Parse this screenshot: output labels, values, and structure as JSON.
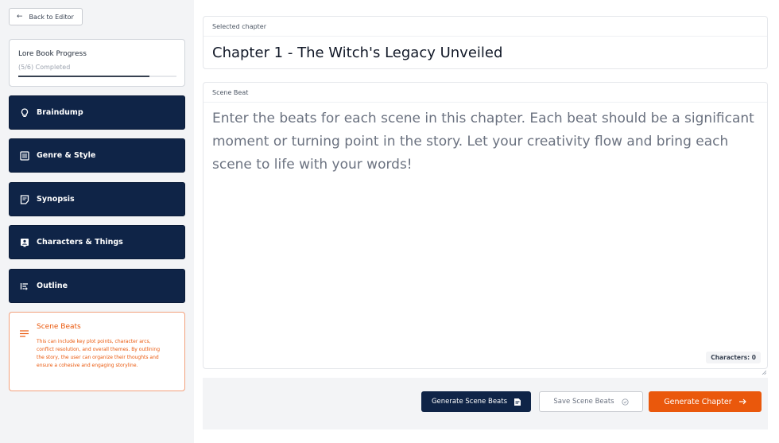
{
  "sidebar": {
    "back_label": "Back to Editor",
    "progress": {
      "title": "Lore Book Progress",
      "status": "(5/6) Completed",
      "fraction": 0.83
    },
    "items": [
      {
        "label": "Braindump",
        "icon": "lightbulb-icon"
      },
      {
        "label": "Genre & Style",
        "icon": "list-box-icon"
      },
      {
        "label": "Synopsis",
        "icon": "document-icon"
      },
      {
        "label": "Characters & Things",
        "icon": "person-card-icon"
      },
      {
        "label": "Outline",
        "icon": "outline-list-icon"
      }
    ],
    "active": {
      "label": "Scene Beats",
      "icon": "lines-icon",
      "description": "This can include key plot points, character arcs, conflict resolution, and overall themes. By outlining the story, the user can organize their thoughts and ensure a cohesive and engaging storyline."
    }
  },
  "main": {
    "chapter": {
      "label": "Selected chapter",
      "value": "Chapter 1 - The Witch's Legacy Unveiled"
    },
    "scene_beat": {
      "label": "Scene Beat",
      "placeholder": "Enter the beats for each scene in this chapter. Each beat should be a significant moment or turning point in the story. Let your creativity flow and bring each scene to life with your words!",
      "char_count": "Characters: 0"
    }
  },
  "actions": {
    "generate_beats": "Generate Scene Beats",
    "save_beats": "Save Scene Beats",
    "generate_chapter": "Generate Chapter"
  },
  "colors": {
    "navy": "#0f2447",
    "accent": "#ea580c"
  }
}
